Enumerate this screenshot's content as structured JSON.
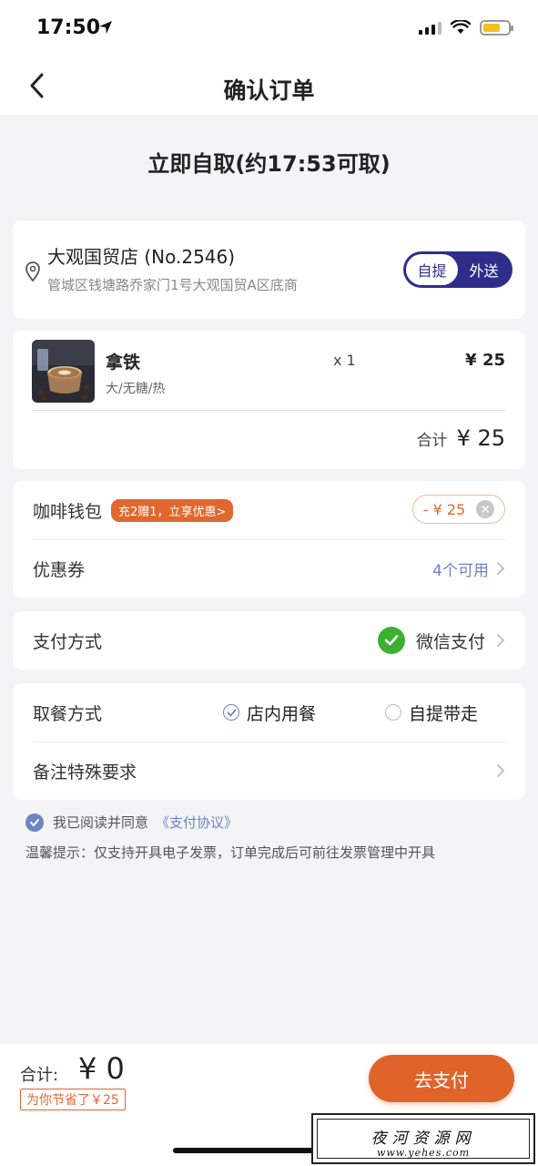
{
  "status_bar": {
    "time": "17:50"
  },
  "nav": {
    "title": "确认订单"
  },
  "pickup": {
    "title": "立即自取(约17:53可取)"
  },
  "store": {
    "name": "大观国贸店 (No.2546)",
    "address": "管城区钱塘路乔家门1号大观国贸A区底商",
    "modes": [
      "自提",
      "外送"
    ],
    "active_mode": "自提"
  },
  "order": {
    "items": [
      {
        "name": "拿铁",
        "spec": "大/无糖/热",
        "qty": "x 1",
        "price": "¥ 25"
      }
    ],
    "total_label": "合计",
    "total_value": "¥ 25"
  },
  "discounts": {
    "wallet_label": "咖啡钱包",
    "wallet_promo": "充2赠1，立享优惠>",
    "wallet_amount": "- ¥ 25",
    "coupon_label": "优惠券",
    "coupon_value": "4个可用"
  },
  "payment": {
    "label": "支付方式",
    "method": "微信支付"
  },
  "dine": {
    "label": "取餐方式",
    "options": [
      "店内用餐",
      "自提带走"
    ],
    "selected": "店内用餐",
    "remark_label": "备注特殊要求"
  },
  "agreement": {
    "text": "我已阅读并同意",
    "link": "《支付协议》"
  },
  "tip": "温馨提示：仅支持开具电子发票，订单完成后可前往发票管理中开具",
  "checkout": {
    "total_label": "合计:",
    "total_value": "¥ 0",
    "saved": "为你节省了￥25",
    "pay_button": "去支付"
  },
  "watermark": {
    "title": "夜河资源网",
    "url": "www.yehes.com"
  },
  "colors": {
    "accent_orange": "#e0642a",
    "brand_navy": "#2e2e8a",
    "link_blue": "#6b84c7",
    "wechat_green": "#3cb030"
  }
}
